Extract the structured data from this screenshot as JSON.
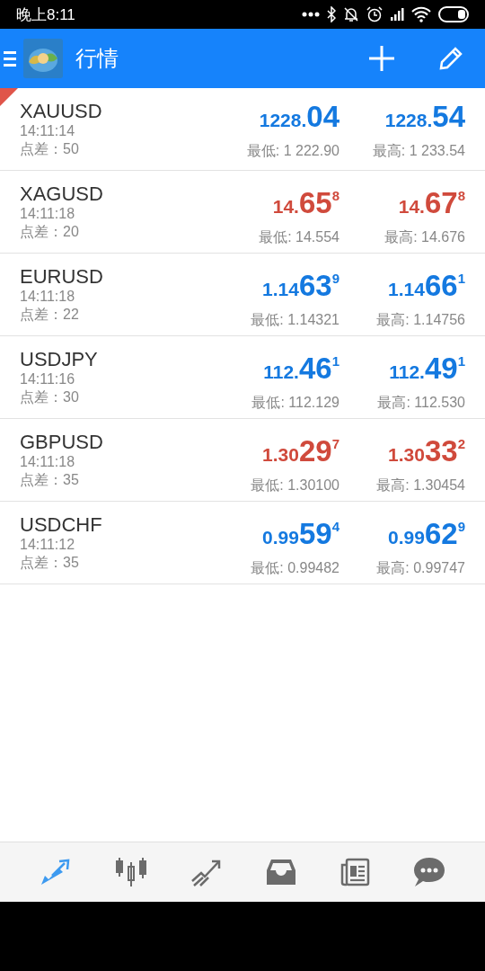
{
  "status_bar": {
    "time": "晚上8:11"
  },
  "header": {
    "title": "行情"
  },
  "quotes": [
    {
      "symbol": "XAUUSD",
      "time": "14:11:14",
      "spread_label": "点差：",
      "spread": "50",
      "selected": true,
      "color": "#1479e0",
      "bid": {
        "prefix": "1228.",
        "big": "04"
      },
      "ask": {
        "prefix": "1228.",
        "big": "54"
      },
      "low": "最低: 1 222.90",
      "high": "最高: 1 233.54"
    },
    {
      "symbol": "XAGUSD",
      "time": "14:11:18",
      "spread_label": "点差：",
      "spread": "20",
      "selected": false,
      "color": "#d04a3c",
      "bid": {
        "prefix": "14.",
        "big": "65",
        "sup": "8"
      },
      "ask": {
        "prefix": "14.",
        "big": "67",
        "sup": "8"
      },
      "low": "最低: 14.554",
      "high": "最高: 14.676"
    },
    {
      "symbol": "EURUSD",
      "time": "14:11:18",
      "spread_label": "点差：",
      "spread": "22",
      "selected": false,
      "color": "#1479e0",
      "bid": {
        "prefix": "1.14",
        "big": "63",
        "sup": "9"
      },
      "ask": {
        "prefix": "1.14",
        "big": "66",
        "sup": "1"
      },
      "low": "最低: 1.14321",
      "high": "最高: 1.14756"
    },
    {
      "symbol": "USDJPY",
      "time": "14:11:16",
      "spread_label": "点差：",
      "spread": "30",
      "selected": false,
      "color": "#1479e0",
      "bid": {
        "prefix": "112.",
        "big": "46",
        "sup": "1"
      },
      "ask": {
        "prefix": "112.",
        "big": "49",
        "sup": "1"
      },
      "low": "最低: 112.129",
      "high": "最高: 112.530"
    },
    {
      "symbol": "GBPUSD",
      "time": "14:11:18",
      "spread_label": "点差：",
      "spread": "35",
      "selected": false,
      "color": "#d04a3c",
      "bid": {
        "prefix": "1.30",
        "big": "29",
        "sup": "7"
      },
      "ask": {
        "prefix": "1.30",
        "big": "33",
        "sup": "2"
      },
      "low": "最低: 1.30100",
      "high": "最高: 1.30454"
    },
    {
      "symbol": "USDCHF",
      "time": "14:11:12",
      "spread_label": "点差：",
      "spread": "35",
      "selected": false,
      "color": "#1479e0",
      "bid": {
        "prefix": "0.99",
        "big": "59",
        "sup": "4"
      },
      "ask": {
        "prefix": "0.99",
        "big": "62",
        "sup": "9"
      },
      "low": "最低: 0.99482",
      "high": "最高: 0.99747"
    }
  ],
  "bottom_nav": [
    {
      "kind": "quotes",
      "selected": true
    },
    {
      "kind": "chart",
      "selected": false
    },
    {
      "kind": "trade",
      "selected": false
    },
    {
      "kind": "history",
      "selected": false
    },
    {
      "kind": "news",
      "selected": false
    },
    {
      "kind": "chat",
      "selected": false
    }
  ]
}
